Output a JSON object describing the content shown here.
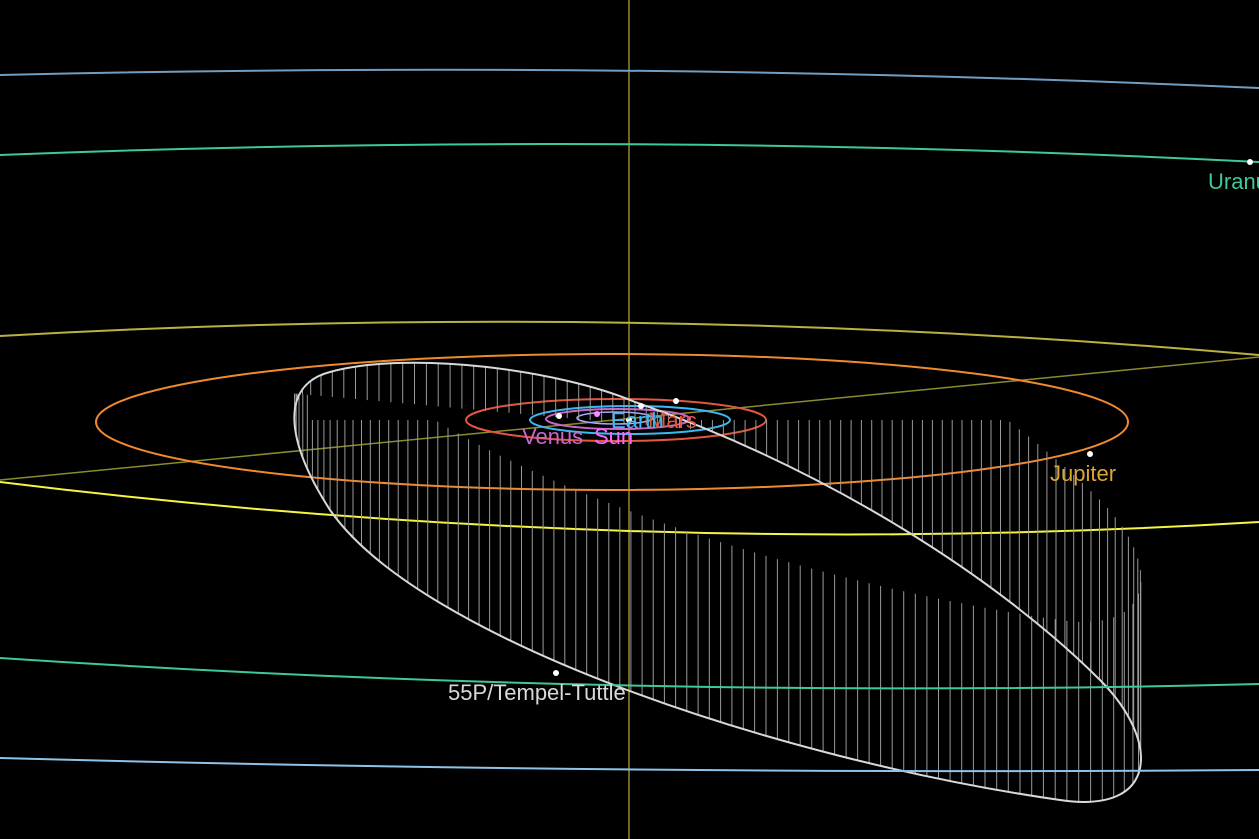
{
  "labels": {
    "uranus": "Uranus",
    "jupiter": "Jupiter",
    "mars": "Mars",
    "earth": "Earth",
    "venus": "Venus",
    "sun": "Sun",
    "comet": "55P/Tempel-Tuttle"
  },
  "colors": {
    "background": "#000000",
    "uranus": "#3fc99a",
    "neptune": "#6f9ec4",
    "saturn": "#d6c94a",
    "jupiter": "#f08a2e",
    "jupiter_label": "#d9a733",
    "mars": "#e2583e",
    "earth": "#3bb9f0",
    "venus": "#cc66cc",
    "mercury": "#a8a8ff",
    "sun": "#f2f2f2",
    "comet": "#d9d9d9",
    "ecliptic_axis": "#bda93c",
    "yellow_orbit": "#f5f542"
  }
}
